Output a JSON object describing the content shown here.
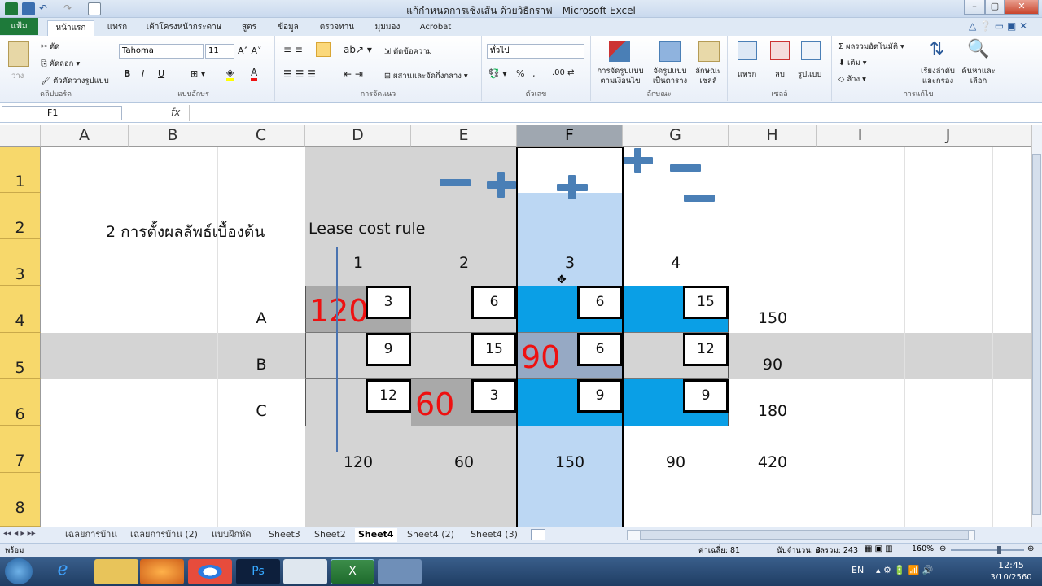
{
  "window": {
    "title": "แก้กำหนดการเชิงเส้น ด้วยวิธีกราฟ - Microsoft Excel",
    "controls": [
      "–",
      "▢",
      "✕"
    ]
  },
  "ribbon_tabs": {
    "file": "แฟ้ม",
    "items": [
      "หน้าแรก",
      "แทรก",
      "เค้าโครงหน้ากระดาษ",
      "สูตร",
      "ข้อมูล",
      "ตรวจทาน",
      "มุมมอง",
      "Acrobat"
    ],
    "active": "หน้าแรก"
  },
  "ribbon": {
    "clipboard": {
      "cut": "ตัด",
      "copy": "คัดลอก",
      "format_painter": "ตัวคัดวางรูปแบบ",
      "paste": "วาง",
      "label": "คลิปบอร์ด"
    },
    "font": {
      "name": "Tahoma",
      "size": "11",
      "label": "แบบอักษร",
      "bold": "B",
      "italic": "I",
      "underline": "U"
    },
    "alignment": {
      "wrap": "ตัดข้อความ",
      "merge": "ผสานและจัดกึ่งกลาง",
      "label": "การจัดแนว"
    },
    "number": {
      "format": "ทั่วไป",
      "label": "ตัวเลข",
      "percent": "%",
      "comma": ","
    },
    "styles": {
      "conditional": "การจัดรูปแบบ\nตามเงื่อนไข",
      "table": "จัดรูปแบบ\nเป็นตาราง",
      "cell": "ลักษณะ\nเซลล์",
      "label": "ลักษณะ"
    },
    "cells": {
      "insert": "แทรก",
      "delete": "ลบ",
      "format": "รูปแบบ",
      "label": "เซลล์"
    },
    "editing": {
      "autosum": "ผลรวมอัตโนมัติ",
      "fill": "เติม",
      "clear": "ล้าง",
      "sort": "เรียงลำดับ\nและกรอง",
      "find": "ค้นหาและ\nเลือก",
      "label": "การแก้ไข"
    }
  },
  "formula_bar": {
    "name_box": "F1",
    "fx": "fx",
    "formula": ""
  },
  "columns": [
    "A",
    "B",
    "C",
    "D",
    "E",
    "F",
    "G",
    "H",
    "I",
    "J"
  ],
  "selected_column": "F",
  "rows": [
    "1",
    "2",
    "3",
    "4",
    "5",
    "6",
    "7",
    "8"
  ],
  "cells": {
    "b2": "2 การตั้งผลลัพธ์เบื้องต้น",
    "d2": "Lease cost rule",
    "d3": "1",
    "e3": "2",
    "f3": "3",
    "g3": "4",
    "c4": "A",
    "c5": "B",
    "c6": "C",
    "h4": "150",
    "h5": "90",
    "h6": "180",
    "d7": "120",
    "e7": "60",
    "f7": "150",
    "g7": "90",
    "h7": "420"
  },
  "cost_boxes": {
    "d4": "3",
    "e4": "6",
    "f4": "6",
    "g4": "15",
    "d5": "9",
    "e5": "15",
    "f5": "6",
    "g5": "12",
    "d6": "12",
    "e6": "3",
    "f6": "9",
    "g6": "9"
  },
  "allocations": {
    "d4": "120",
    "f5": "90",
    "e6": "60"
  },
  "colors": {
    "accent_blue": "#0a9fe6",
    "light_blue": "#bcd7f3",
    "gray_fill": "#d4d4d4",
    "dark_gray": "#a9a9a9",
    "red": "#e11111",
    "row_header": "#f7d86b"
  },
  "sheet_tabs": {
    "items": [
      "เฉลยการบ้าน",
      "เฉลยการบ้าน (2)",
      "แบบฝึกหัด",
      "Sheet3",
      "Sheet2",
      "Sheet4",
      "Sheet4 (2)",
      "Sheet4 (3)"
    ],
    "active": "Sheet4"
  },
  "status": {
    "ready": "พร้อม",
    "average": "ค่าเฉลี่ย: 81",
    "count": "นับจำนวน: 3",
    "sum": "ผลรวม: 243",
    "zoom": "160%"
  },
  "taskbar": {
    "lang": "EN",
    "time": "12:45",
    "date": "3/10/2560"
  }
}
